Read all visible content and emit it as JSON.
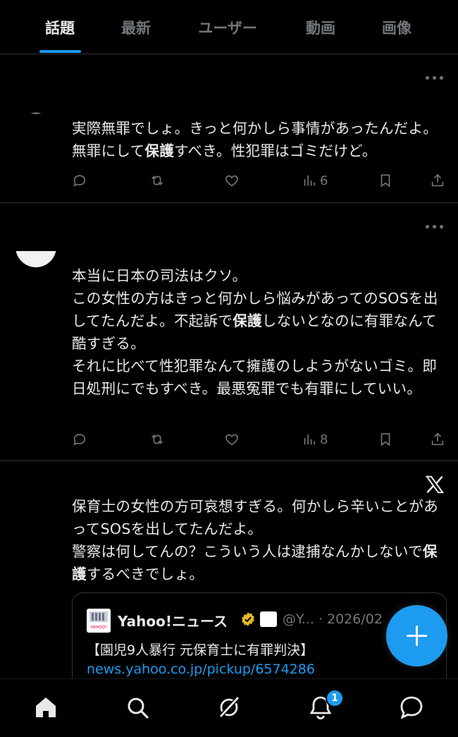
{
  "tabs": [
    {
      "label": "話題",
      "active": true
    },
    {
      "label": "最新",
      "active": false
    },
    {
      "label": "ユーザー",
      "active": false
    },
    {
      "label": "動画",
      "active": false
    },
    {
      "label": "画像",
      "active": false
    }
  ],
  "posts": [
    {
      "text_before": "実際無罪でしょ。きっと何かしら事情があったんだよ。無罪にして",
      "text_bold": "保護",
      "text_after": "すべき。性犯罪はゴミだけど。",
      "views": "6"
    },
    {
      "text_before": "本当に日本の司法はクソ。\nこの女性の方はきっと何かしら悩みがあってのSOSを出してたんだよ。不起訴で",
      "text_bold": "保護",
      "text_after": "しないとなのに有罪なんて酷すぎる。\nそれに比べて性犯罪なんて擁護のしようがないゴミ。即日処刑にでもすべき。最悪冤罪でも有罪にしていい。",
      "views": "8"
    },
    {
      "text_before": "保育士の女性の方可哀想すぎる。何かしら辛いことがあってSOSを出してたんだよ。\n警察は何してんの？こういう人は逮捕なんかしないで",
      "text_bold": "保護",
      "text_after": "するべきでしょ。"
    }
  ],
  "card": {
    "logo_text": "YAHOO!",
    "name": "Yahoo!ニュース",
    "handle": "@Y... · 2026/02",
    "title": "【園児9人暴行 元保育士に有罪判決】",
    "url": "news.yahoo.co.jp/pickup/6574286"
  },
  "notifications_badge": "1",
  "colors": {
    "accent": "#1d9bf0",
    "muted": "#71767b",
    "text": "#e7e9ea",
    "border": "#2f3336",
    "verified": "#e8b923"
  },
  "icons": {
    "post_actions": [
      "reply-icon",
      "repost-icon",
      "like-icon",
      "views-icon",
      "bookmark-icon",
      "share-icon"
    ],
    "bottom_nav": [
      "home-icon",
      "search-icon",
      "grok-icon",
      "notifications-icon",
      "messages-icon"
    ]
  }
}
